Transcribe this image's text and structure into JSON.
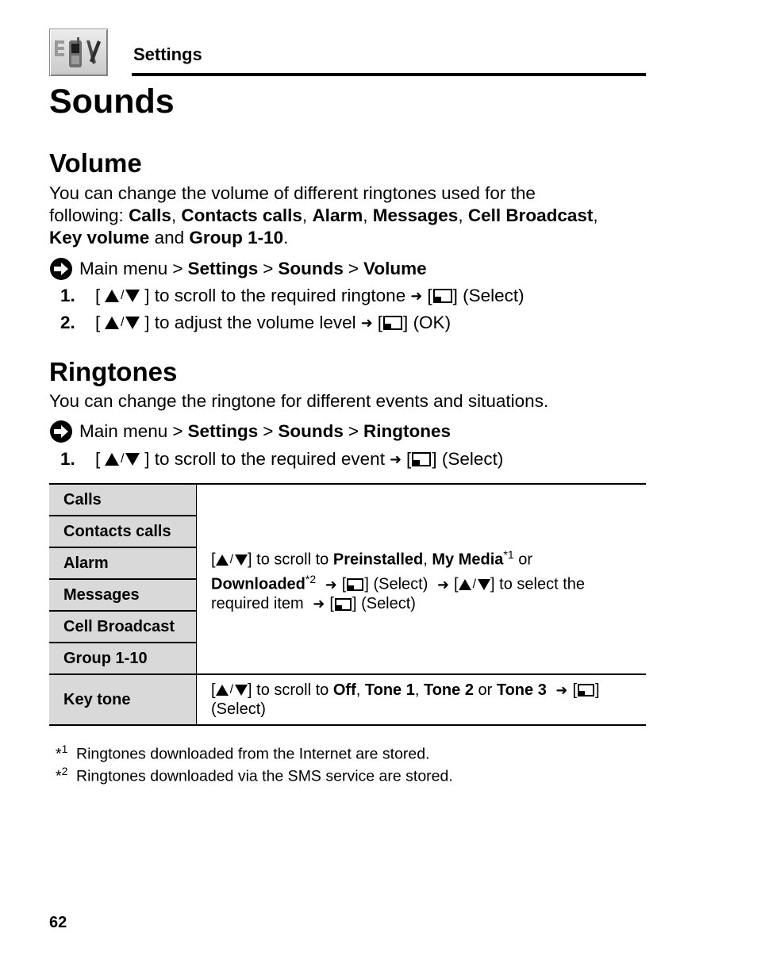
{
  "header": {
    "section_icon": "settings-phone-tools-icon",
    "section_label": "Settings"
  },
  "page_title": "Sounds",
  "volume": {
    "heading": "Volume",
    "intro_prefix": "You can change the volume of different ringtones used for the following: ",
    "intro_items": [
      "Calls",
      "Contacts calls",
      "Alarm",
      "Messages",
      "Cell Broadcast",
      "Key volume"
    ],
    "intro_and": " and ",
    "intro_last": "Group 1-10",
    "menu_path": {
      "icon": "arrow-right-circle-icon",
      "root": "Main menu",
      "separator": ">",
      "items": [
        "Settings",
        "Sounds",
        "Volume"
      ]
    },
    "steps": [
      {
        "number": "1.",
        "text": "to scroll to the required ringtone",
        "action": "(Select)"
      },
      {
        "number": "2.",
        "text": "to adjust the volume level",
        "action": "(OK)"
      }
    ]
  },
  "ringtones": {
    "heading": "Ringtones",
    "intro": "You can change the ringtone for different events and situations.",
    "menu_path": {
      "icon": "arrow-right-circle-icon",
      "root": "Main menu",
      "separator": ">",
      "items": [
        "Settings",
        "Sounds",
        "Ringtones"
      ]
    },
    "steps": [
      {
        "number": "1.",
        "text": "to scroll to the required event",
        "action": "(Select)"
      }
    ],
    "table": {
      "events": [
        "Calls",
        "Contacts calls",
        "Alarm",
        "Messages",
        "Cell Broadcast",
        "Group 1-10"
      ],
      "events_description": {
        "scroll_to": "to scroll to",
        "opt1": "Preinstalled",
        "opt2": "My Media",
        "opt2_note": "*1",
        "or": "or",
        "opt3": "Downloaded",
        "opt3_note": "*2",
        "select": "(Select)",
        "select_the": "to select the required item",
        "select2": "(Select)"
      },
      "key_tone": {
        "label": "Key tone",
        "scroll_to": "to scroll to",
        "options": [
          "Off",
          "Tone 1",
          "Tone 2"
        ],
        "or": "or",
        "last_option": "Tone 3",
        "action": "(Select)"
      }
    }
  },
  "footnotes": [
    {
      "mark": "*",
      "num": "1",
      "text": "Ringtones downloaded from the Internet are stored."
    },
    {
      "mark": "*",
      "num": "2",
      "text": "Ringtones downloaded via the SMS service are stored."
    }
  ],
  "page_number": "62"
}
